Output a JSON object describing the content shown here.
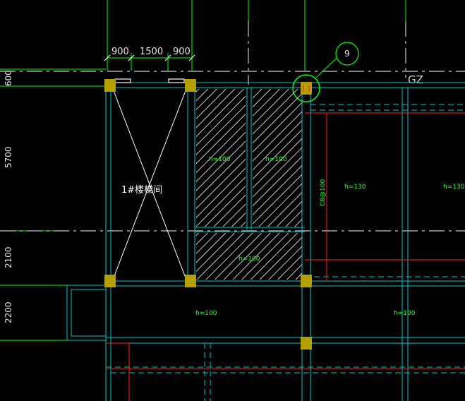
{
  "dimensions": {
    "top": [
      "900",
      "1500",
      "900"
    ],
    "left": [
      "600",
      "5700",
      "2100",
      "2200"
    ]
  },
  "grid_bubble": "9",
  "column_tag": "GZ",
  "shaft_label": "1#楼梯间",
  "slab_labels": [
    "h=100",
    "h=100",
    "h=100",
    "h=130",
    "h=130",
    "h=100",
    "h=100"
  ],
  "beam_label": "C8@100",
  "colors": {
    "background": "#000000",
    "grid_line": "#c8c8c8",
    "wall": "#00c8c8",
    "dim_line": "#00ff00",
    "column": "#b4a000",
    "rebar": "#ff2020",
    "bubble": "#00ff00"
  }
}
